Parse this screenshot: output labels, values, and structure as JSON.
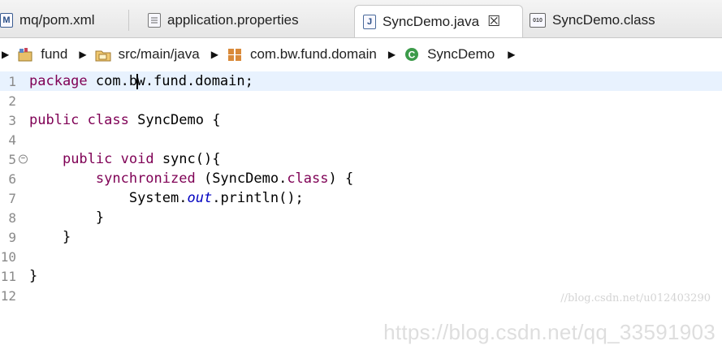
{
  "tabs": [
    {
      "label": "mq/pom.xml",
      "icon": "maven-m-icon",
      "badge": "M"
    },
    {
      "label": "application.properties",
      "icon": "properties-file-icon"
    },
    {
      "label": "SyncDemo.java",
      "icon": "java-file-icon",
      "badge": "J",
      "active": true,
      "close": "☒"
    },
    {
      "label": "SyncDemo.class",
      "icon": "class-file-icon",
      "badge": "010"
    }
  ],
  "breadcrumb": [
    {
      "label": "fund",
      "icon": "project-icon"
    },
    {
      "label": "src/main/java",
      "icon": "source-folder-icon"
    },
    {
      "label": "com.bw.fund.domain",
      "icon": "package-icon"
    },
    {
      "label": "SyncDemo",
      "icon": "class-icon"
    }
  ],
  "editor": {
    "lines": [
      {
        "n": "1"
      },
      {
        "n": "2"
      },
      {
        "n": "3"
      },
      {
        "n": "4"
      },
      {
        "n": "5"
      },
      {
        "n": "6"
      },
      {
        "n": "7"
      },
      {
        "n": "8"
      },
      {
        "n": "9"
      },
      {
        "n": "10"
      },
      {
        "n": "11"
      },
      {
        "n": "12"
      }
    ],
    "code": {
      "l1a": "package",
      "l1b": " com.b",
      "l1c": "w.fund.domain;",
      "l3a": "public",
      "l3b": "class",
      "l3c": " SyncDemo {",
      "l5a": "public",
      "l5b": "void",
      "l5c": " sync(){",
      "l6a": "synchronized",
      "l6b": " (SyncDemo.",
      "l6c": "class",
      "l6d": ") {",
      "l7a": "System.",
      "l7b": "out",
      "l7c": ".println();",
      "l8": "}",
      "l9": "}",
      "l11": "}"
    }
  },
  "watermarks": {
    "small": "//blog.csdn.net/u012403290",
    "large": "https://blog.csdn.net/qq_33591903"
  }
}
